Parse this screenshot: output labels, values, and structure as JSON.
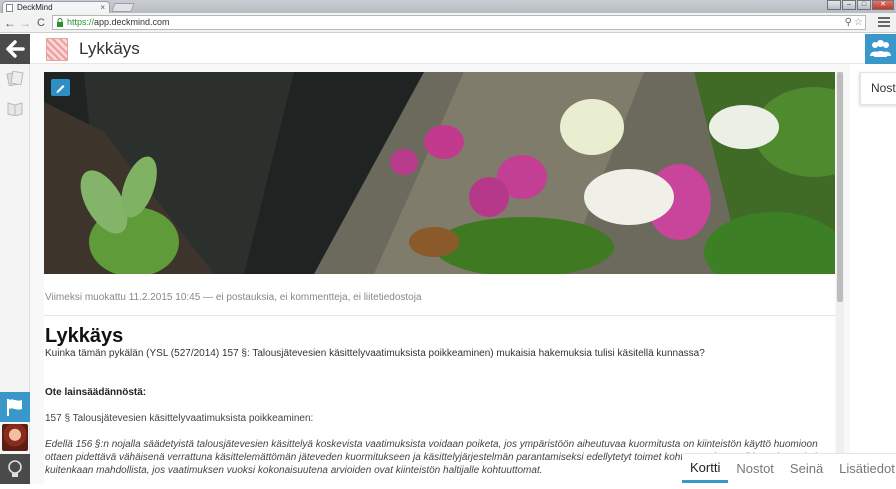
{
  "browser": {
    "tab_title": "DeckMind",
    "tab_close": "×",
    "url_scheme": "https://",
    "url_host": "app.deckmind.com",
    "nav_back": "←",
    "nav_forward": "→",
    "nav_reload": "C",
    "zoom_icon": "⚲",
    "star_icon": "☆"
  },
  "header": {
    "title": "Lykkäys"
  },
  "side_panel": {
    "tab_label": "Nost"
  },
  "content": {
    "meta_line": "Viimeksi muokattu 11.2.2015 10:45 — ei postauksia, ei kommentteja, ei liitetiedostoja",
    "doc_title": "Lykkäys",
    "doc_description": "Kuinka tämän pykälän (YSL (527/2014) 157 §: Talousjätevesien käsittelyvaatimuksista poikkeaminen) mukaisia hakemuksia tulisi käsitellä kunnassa?",
    "section_heading": "Ote lainsäädännöstä:",
    "law_title": "157 § Talousjätevesien käsittelyvaatimuksista poikkeaminen:",
    "law_quote": "Edellä 156 §:n nojalla säädetyistä talousjätevesien käsittelyä koskevista vaatimuksista voidaan poiketa, jos ympäristöön aiheutuvaa kuormitusta on kiinteistön käyttö huomioon ottaen pidettävä vähäisenä verrattuna käsittelemättömän jäteveden kuormitukseen ja käsittelyjärjestelmän parantamiseksi edellytetyt toimet kohtuuttomina. Poikkeaminen ei ole kuitenkaan mahdollista, jos vaatimuksen vuoksi kokonaisuutena arvioiden ovat kiinteistön haltijalle kohtuuttomat."
  },
  "bottom_tabs": [
    {
      "label": "Kortti",
      "active": true
    },
    {
      "label": "Nostot",
      "active": false
    },
    {
      "label": "Seinä",
      "active": false
    },
    {
      "label": "Lisätiedot",
      "active": false
    }
  ],
  "colors": {
    "accent": "#3a97c9",
    "rail_dark": "#4a4a4a"
  },
  "icons": {
    "back": "arrow-left-icon",
    "cards": "cards-icon",
    "book": "book-icon",
    "edit": "pencil-icon",
    "flag": "flag-icon",
    "bulb": "lightbulb-icon",
    "users": "users-icon"
  }
}
